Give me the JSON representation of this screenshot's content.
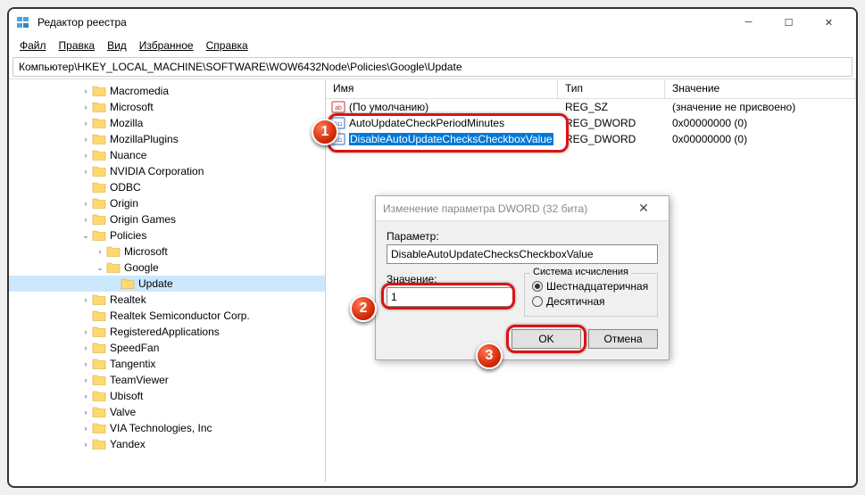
{
  "window": {
    "title": "Редактор реестра"
  },
  "menu": {
    "file": "Файл",
    "edit": "Правка",
    "view": "Вид",
    "favorites": "Избранное",
    "help": "Справка"
  },
  "address": "Компьютер\\HKEY_LOCAL_MACHINE\\SOFTWARE\\WOW6432Node\\Policies\\Google\\Update",
  "list_headers": {
    "name": "Имя",
    "type": "Тип",
    "value": "Значение"
  },
  "list_rows": [
    {
      "name": "(По умолчанию)",
      "type": "REG_SZ",
      "value": "(значение не присвоено)",
      "icon": "sz"
    },
    {
      "name": "AutoUpdateCheckPeriodMinutes",
      "type": "REG_DWORD",
      "value": "0x00000000 (0)",
      "icon": "dw"
    },
    {
      "name": "DisableAutoUpdateChecksCheckboxValue",
      "type": "REG_DWORD",
      "value": "0x00000000 (0)",
      "icon": "dw",
      "selected": true
    }
  ],
  "tree": [
    {
      "indent": 5,
      "exp": ">",
      "name": "Macromedia"
    },
    {
      "indent": 5,
      "exp": ">",
      "name": "Microsoft"
    },
    {
      "indent": 5,
      "exp": ">",
      "name": "Mozilla"
    },
    {
      "indent": 5,
      "exp": ">",
      "name": "MozillaPlugins"
    },
    {
      "indent": 5,
      "exp": ">",
      "name": "Nuance"
    },
    {
      "indent": 5,
      "exp": ">",
      "name": "NVIDIA Corporation"
    },
    {
      "indent": 5,
      "exp": "",
      "name": "ODBC"
    },
    {
      "indent": 5,
      "exp": ">",
      "name": "Origin"
    },
    {
      "indent": 5,
      "exp": ">",
      "name": "Origin Games"
    },
    {
      "indent": 5,
      "exp": "v",
      "name": "Policies"
    },
    {
      "indent": 6,
      "exp": ">",
      "name": "Microsoft"
    },
    {
      "indent": 6,
      "exp": "v",
      "name": "Google"
    },
    {
      "indent": 7,
      "exp": "",
      "name": "Update",
      "selected": true
    },
    {
      "indent": 5,
      "exp": ">",
      "name": "Realtek"
    },
    {
      "indent": 5,
      "exp": "",
      "name": "Realtek Semiconductor Corp."
    },
    {
      "indent": 5,
      "exp": ">",
      "name": "RegisteredApplications"
    },
    {
      "indent": 5,
      "exp": ">",
      "name": "SpeedFan"
    },
    {
      "indent": 5,
      "exp": ">",
      "name": "Tangentix"
    },
    {
      "indent": 5,
      "exp": ">",
      "name": "TeamViewer"
    },
    {
      "indent": 5,
      "exp": ">",
      "name": "Ubisoft"
    },
    {
      "indent": 5,
      "exp": ">",
      "name": "Valve"
    },
    {
      "indent": 5,
      "exp": ">",
      "name": "VIA Technologies, Inc"
    },
    {
      "indent": 5,
      "exp": ">",
      "name": "Yandex"
    }
  ],
  "dialog": {
    "title": "Изменение параметра DWORD (32 бита)",
    "param_label": "Параметр:",
    "param_value": "DisableAutoUpdateChecksCheckboxValue",
    "value_label": "Значение:",
    "value_input": "1",
    "radix_group": "Система исчисления",
    "radix_hex": "Шестнадцатеричная",
    "radix_dec": "Десятичная",
    "ok": "OK",
    "cancel": "Отмена"
  },
  "badges": {
    "b1": "1",
    "b2": "2",
    "b3": "3"
  }
}
